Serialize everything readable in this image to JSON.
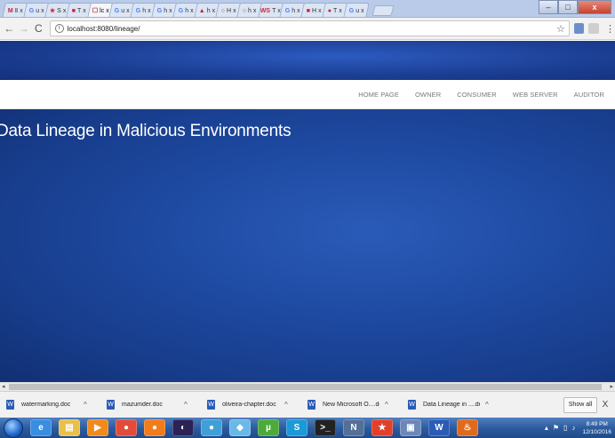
{
  "browser": {
    "tabs": [
      {
        "label": "M",
        "title": "Ⅱ"
      },
      {
        "label": "G",
        "title": "u"
      },
      {
        "label": "★",
        "title": "S"
      },
      {
        "label": "■",
        "title": "T"
      },
      {
        "label": "☐",
        "title": "lc"
      },
      {
        "label": "G",
        "title": "u"
      },
      {
        "label": "G",
        "title": "h"
      },
      {
        "label": "G",
        "title": "h"
      },
      {
        "label": "G",
        "title": "h"
      },
      {
        "label": "▲",
        "title": "h"
      },
      {
        "label": "○",
        "title": "H"
      },
      {
        "label": "○",
        "title": "h"
      },
      {
        "label": "WS",
        "title": "T"
      },
      {
        "label": "G",
        "title": "h"
      },
      {
        "label": "■",
        "title": "H"
      },
      {
        "label": "●",
        "title": "T"
      },
      {
        "label": "G",
        "title": "u"
      }
    ],
    "tab_close": "x",
    "window": {
      "minimize": "‒",
      "maximize": "□",
      "close": "x"
    },
    "nav": {
      "back": "←",
      "forward": "→",
      "reload": "C"
    },
    "address": "localhost:8080/lineage/",
    "info_icon": "i",
    "star": "☆",
    "menu": "⋮"
  },
  "site": {
    "nav": [
      {
        "label": "HOME PAGE"
      },
      {
        "label": "OWNER"
      },
      {
        "label": "CONSUMER"
      },
      {
        "label": "WEB SERVER"
      },
      {
        "label": "AUDITOR"
      }
    ],
    "title": "Data Lineage in Malicious Environments",
    "colors": {
      "banner": "#1e4aa2",
      "navbar": "#ffffff"
    }
  },
  "scrollbar": {
    "left": "◂",
    "right": "▸"
  },
  "downloads": {
    "items": [
      {
        "name": "watermarking.doc"
      },
      {
        "name": "mazumder.doc"
      },
      {
        "name": "oliveira-chapter.doc"
      },
      {
        "name": "New Microsoft O....docx"
      },
      {
        "name": "Data Lineage in ....docx"
      }
    ],
    "doc_icon": "W",
    "caret": "^",
    "show_all": "Show all",
    "close": "X"
  },
  "taskbar": {
    "apps": [
      {
        "name": "ie-icon",
        "glyph": "e",
        "color": "#3a8de0"
      },
      {
        "name": "folder-icon",
        "glyph": "▤",
        "color": "#e8c04a"
      },
      {
        "name": "media-player-icon",
        "glyph": "▶",
        "color": "#f08a1c"
      },
      {
        "name": "chrome-icon",
        "glyph": "●",
        "color": "#e04b3a"
      },
      {
        "name": "firefox-icon",
        "glyph": "●",
        "color": "#f27b1a"
      },
      {
        "name": "eclipse-icon",
        "glyph": "◐",
        "color": "#2c2255"
      },
      {
        "name": "globe-icon",
        "glyph": "●",
        "color": "#3fa0d8"
      },
      {
        "name": "app-icon",
        "glyph": "◆",
        "color": "#69b8e8"
      },
      {
        "name": "utorrent-icon",
        "glyph": "µ",
        "color": "#4caa3a"
      },
      {
        "name": "skype-icon",
        "glyph": "S",
        "color": "#1a9ad6"
      },
      {
        "name": "cmd-icon",
        "glyph": ">_",
        "color": "#222"
      },
      {
        "name": "text-editor-icon",
        "glyph": "N",
        "color": "#556f95"
      },
      {
        "name": "star-app-icon",
        "glyph": "★",
        "color": "#e0402a"
      },
      {
        "name": "paint-icon",
        "glyph": "▣",
        "color": "#6d87b8"
      },
      {
        "name": "word-icon",
        "glyph": "W",
        "color": "#2b5bb5"
      },
      {
        "name": "java-icon",
        "glyph": "♨",
        "color": "#e06a1c"
      }
    ],
    "time": "8:49 PM",
    "date": "12/10/2016",
    "tray_up": "▴",
    "flag": "⚑",
    "network": "▯",
    "volume": "♪"
  }
}
